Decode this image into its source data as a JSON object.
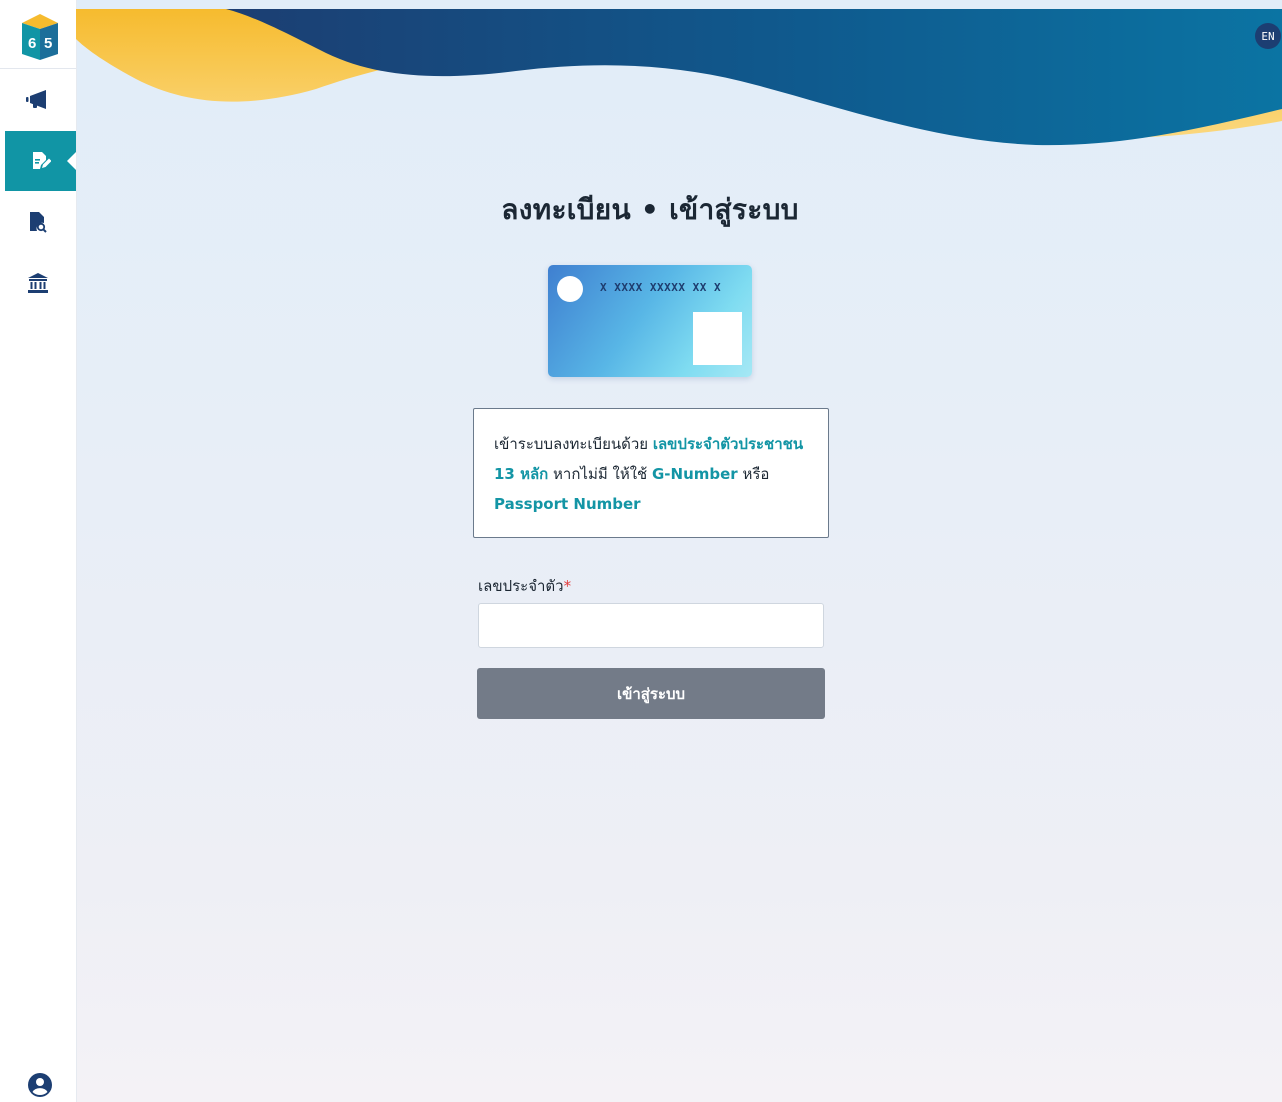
{
  "logo": {
    "digits": [
      "6",
      "5"
    ]
  },
  "sidebar": {
    "items": [
      {
        "icon": "megaphone-icon",
        "active": false
      },
      {
        "icon": "edit-document-icon",
        "active": true
      },
      {
        "icon": "document-search-icon",
        "active": false
      },
      {
        "icon": "bank-icon",
        "active": false
      }
    ],
    "profile_icon": "user-circle-icon"
  },
  "header": {
    "lang_button": "EN"
  },
  "page": {
    "title": "ลงทะเบียน • เข้าสู่ระบบ"
  },
  "id_card": {
    "number_mask": "X XXXX XXXXX XX X"
  },
  "info": {
    "text1": "เข้าระบบลงทะเบียนด้วย ",
    "highlight1": "เลขประจำตัวประชาชน 13 หลัก",
    "text2": " หากไม่มี ให้ใช้ ",
    "highlight2": "G-Number",
    "text3": " หรือ ",
    "highlight3": "Passport Number"
  },
  "form": {
    "id_label": "เลขประจำตัว",
    "required_mark": "*",
    "id_value": "",
    "id_placeholder": "",
    "submit_label": "เข้าสู่ระบบ"
  },
  "colors": {
    "accent": "#1195a5",
    "navy": "#1c3e72",
    "wave_yellow": "#f6bb2e",
    "button_disabled": "#737b88",
    "required": "#e23b3b"
  }
}
